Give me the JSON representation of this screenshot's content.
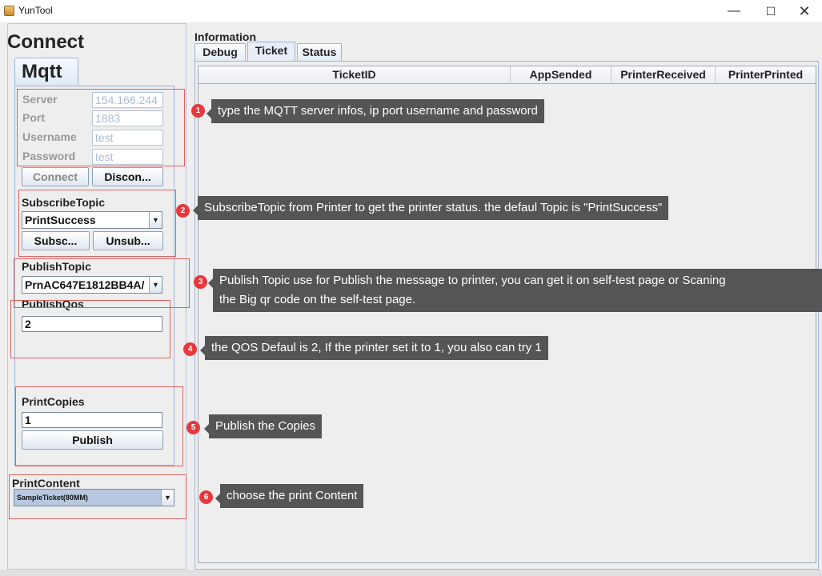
{
  "window": {
    "title": "YunTool",
    "minimize": "—",
    "maximize": "☐",
    "close": "✕"
  },
  "connect": {
    "title": "Connect",
    "tab_label": "Mqtt",
    "server": {
      "label": "Server",
      "value": "154.166.244"
    },
    "port": {
      "label": "Port",
      "value": "1883"
    },
    "username": {
      "label": "Username",
      "value": "test"
    },
    "password": {
      "label": "Password",
      "value": "test"
    },
    "connect_button": "Connect",
    "disconnect_button": "Discon..."
  },
  "subscribe": {
    "label": "SubscribeTopic",
    "selected": "PrintSuccess",
    "subscribe_button": "Subsc...",
    "unsubscribe_button": "Unsub..."
  },
  "publish": {
    "topic_label": "PublishTopic",
    "topic_selected": "PrnAC647E1812BB4A/",
    "qos_label": "PublishQos",
    "qos_value": "2",
    "copies_label": "PrintCopies",
    "copies_value": "1",
    "publish_button": "Publish"
  },
  "print_content": {
    "label": "PrintContent",
    "selected": "SampleTicket(80MM)"
  },
  "information": {
    "label": "Information",
    "tabs": [
      "Debug",
      "Ticket",
      "Status"
    ],
    "selected_tab": "Ticket",
    "columns": [
      "TicketID",
      "AppSended",
      "PrinterReceived",
      "PrinterPrinted"
    ]
  },
  "annotations": [
    {
      "number": "1",
      "text": "type the MQTT server infos, ip port username and password"
    },
    {
      "number": "2",
      "text": "SubscribeTopic from Printer to get the printer status. the defaul Topic is \"PrintSuccess\""
    },
    {
      "number": "3",
      "line1": "Publish Topic use for Publish the message to printer,  you can get it on self-test page or Scaning",
      "line2": "the Big qr code on the self-test page."
    },
    {
      "number": "4",
      "text": "the QOS Defaul is 2,  If the printer set it to 1, you also can try 1"
    },
    {
      "number": "5",
      "text": "Publish the Copies"
    },
    {
      "number": "6",
      "text": "choose the print Content"
    }
  ],
  "colors": {
    "annotation_bubble": "#555555",
    "annotation_badge": "#e8383d",
    "highlight_box": "#e06060",
    "panel_border": "#9fb6d4"
  }
}
